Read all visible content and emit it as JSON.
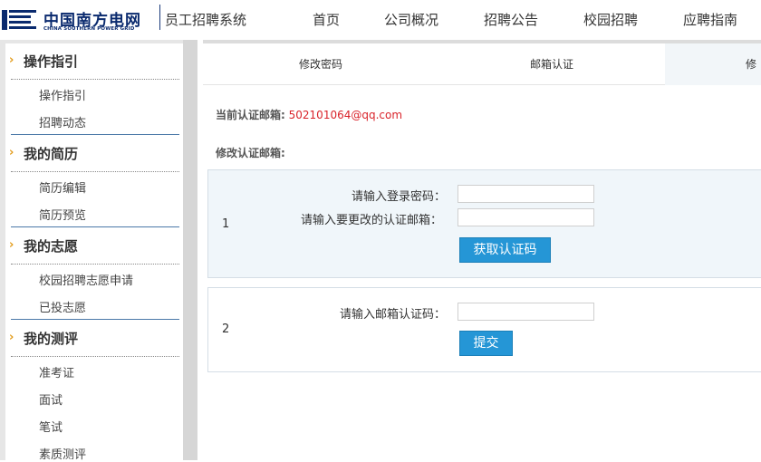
{
  "header": {
    "logo_cn": "中国南方电网",
    "logo_en": "CHINA SOUTHERN POWER GRID",
    "system_title": "员工招聘系统",
    "nav": [
      "首页",
      "公司概况",
      "招聘公告",
      "校园招聘",
      "应聘指南"
    ]
  },
  "sidebar": {
    "sections": [
      {
        "title": "操作指引",
        "items": [
          "操作指引",
          "招聘动态"
        ]
      },
      {
        "title": "我的简历",
        "items": [
          "简历编辑",
          "简历预览"
        ]
      },
      {
        "title": "我的志愿",
        "items": [
          "校园招聘志愿申请",
          "已投志愿"
        ]
      },
      {
        "title": "我的测评",
        "items": [
          "准考证",
          "面试",
          "笔试",
          "素质测评"
        ]
      }
    ]
  },
  "tabs": [
    "修改密码",
    "邮箱认证",
    "修"
  ],
  "current_email": {
    "label": "当前认证邮箱:",
    "value": "502101064@qq.com"
  },
  "modify_label": "修改认证邮箱:",
  "step1": {
    "number": "1",
    "password_label": "请输入登录密码：",
    "new_email_label": "请输入要更改的认证邮箱：",
    "button": "获取认证码"
  },
  "step2": {
    "number": "2",
    "code_label": "请输入邮箱认证码：",
    "button": "提交"
  },
  "colors": {
    "accent": "#2596d6",
    "email_red": "#d9232a",
    "arrow": "#e29b1a"
  }
}
